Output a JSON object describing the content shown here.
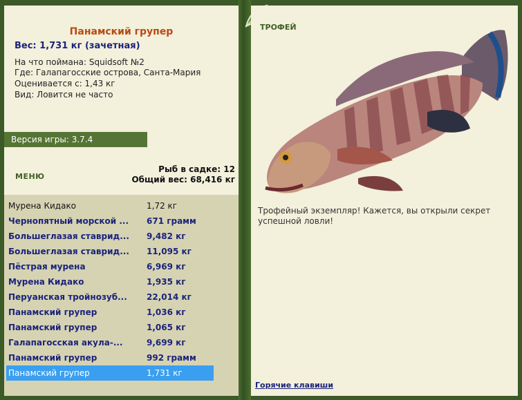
{
  "fish": {
    "name": "Панамский групер",
    "weight": "Вес: 1,731 кг (зачетная)",
    "caught_with": "На что поймана: Squidsoft №2",
    "where": "Где: Галапагосские острова, Санта-Мария",
    "valued_from": "Оценивается с: 1,43 кг",
    "kind": "Вид: Ловится не часто"
  },
  "version": "Версия игры: 3.7.4",
  "menu_label": "МЕНЮ",
  "stats": {
    "in_keepnet": "Рыб в садке: 12",
    "total_weight": "Общий вес: 68,416 кг"
  },
  "catch_list": [
    {
      "name": "Мурена Кидако",
      "weight": "1,72 кг",
      "style": "plain"
    },
    {
      "name": "Чернопятный морской ...",
      "weight": "671 грамм",
      "style": "bold"
    },
    {
      "name": "Большеглазая ставрид...",
      "weight": "9,482 кг",
      "style": "bold"
    },
    {
      "name": "Большеглазая ставрид...",
      "weight": "11,095 кг",
      "style": "bold"
    },
    {
      "name": "Пёстрая мурена",
      "weight": "6,969 кг",
      "style": "bold"
    },
    {
      "name": "Мурена Кидако",
      "weight": "1,935 кг",
      "style": "bold"
    },
    {
      "name": "Перуанская тройнозуб...",
      "weight": "22,014 кг",
      "style": "bold"
    },
    {
      "name": "Панамский групер",
      "weight": "1,036 кг",
      "style": "bold"
    },
    {
      "name": "Панамский групер",
      "weight": "1,065 кг",
      "style": "bold"
    },
    {
      "name": "Галапагосская акула-...",
      "weight": "9,699 кг",
      "style": "bold"
    },
    {
      "name": "Панамский групер",
      "weight": "992 грамм",
      "style": "bold"
    },
    {
      "name": "Панамский групер",
      "weight": "1,731 кг",
      "style": "selected"
    }
  ],
  "trophy": {
    "title": "ТРОФЕЙ",
    "text": "Трофейный экземпляр! Кажется, вы открыли секрет успешной ловли!"
  },
  "hotkeys_label": "Горячие клавиши",
  "colors": {
    "frame": "#3c5a28",
    "panel": "#f3f0dc",
    "list_bg": "#d6d3b3",
    "accent_green": "#557534",
    "name_orange": "#b84a10",
    "navy": "#1b237a",
    "selection": "#3a9ff0"
  }
}
